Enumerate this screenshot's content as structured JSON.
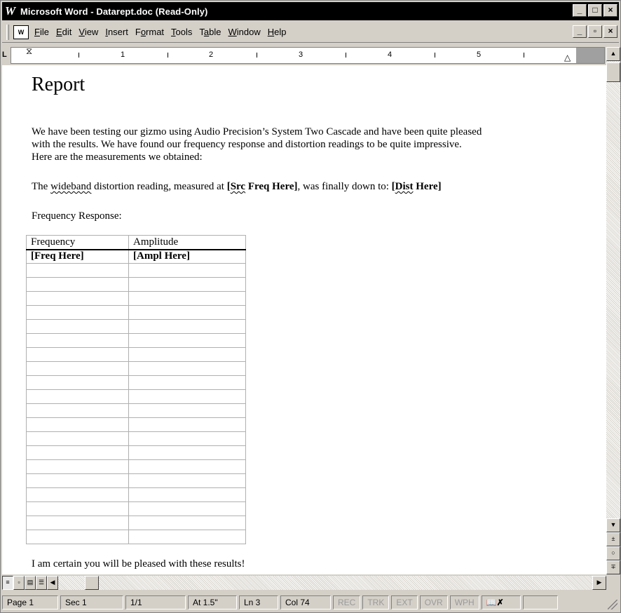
{
  "window": {
    "app_icon": "W",
    "title": "Microsoft Word - Datarept.doc (Read-Only)",
    "controls": [
      "_",
      "□",
      "×"
    ]
  },
  "menubar": {
    "items": [
      {
        "label": "File",
        "key": "F"
      },
      {
        "label": "Edit",
        "key": "E"
      },
      {
        "label": "View",
        "key": "V"
      },
      {
        "label": "Insert",
        "key": "I"
      },
      {
        "label": "Format",
        "key": "o"
      },
      {
        "label": "Tools",
        "key": "T"
      },
      {
        "label": "Table",
        "key": "a"
      },
      {
        "label": "Window",
        "key": "W"
      },
      {
        "label": "Help",
        "key": "H"
      }
    ],
    "doc_controls": [
      "_",
      "▫",
      "×"
    ]
  },
  "ruler": {
    "numbers": [
      "1",
      "2",
      "3",
      "4",
      "5"
    ],
    "tab_selector": "L"
  },
  "document": {
    "heading": "Report",
    "intro_line1": "We have been testing our gizmo using Audio Precision’s System Two Cascade and have been quite pleased",
    "intro_line2": "with the results.  We have found our frequency response and distortion readings to be quite impressive.",
    "intro_line3": "Here are the measurements we obtained:",
    "dist_prefix": "The ",
    "dist_wideband": "wideband",
    "dist_middle": " distortion reading, measured at ",
    "dist_src_open": "[",
    "dist_src_word": "Src",
    "dist_src_rest": " Freq  Here]",
    "dist_after": ", was finally down to: ",
    "dist_val_open": "[",
    "dist_val_word": "Dist",
    "dist_val_rest": " Here]",
    "freq_label": "Frequency Response:",
    "table": {
      "headers": [
        "Frequency",
        "Amplitude"
      ],
      "row1": [
        "[Freq Here]",
        "[Ampl Here]"
      ],
      "empty_rows": 20
    },
    "closing": "I am certain you will be pleased with these results!"
  },
  "statusbar": {
    "page": "Page 1",
    "sec": "Sec 1",
    "pages": "1/1",
    "at": "At 1.5\"",
    "ln": "Ln 3",
    "col": "Col 74",
    "rec": "REC",
    "trk": "TRK",
    "ext": "EXT",
    "ovr": "OVR",
    "wph": "WPH"
  }
}
